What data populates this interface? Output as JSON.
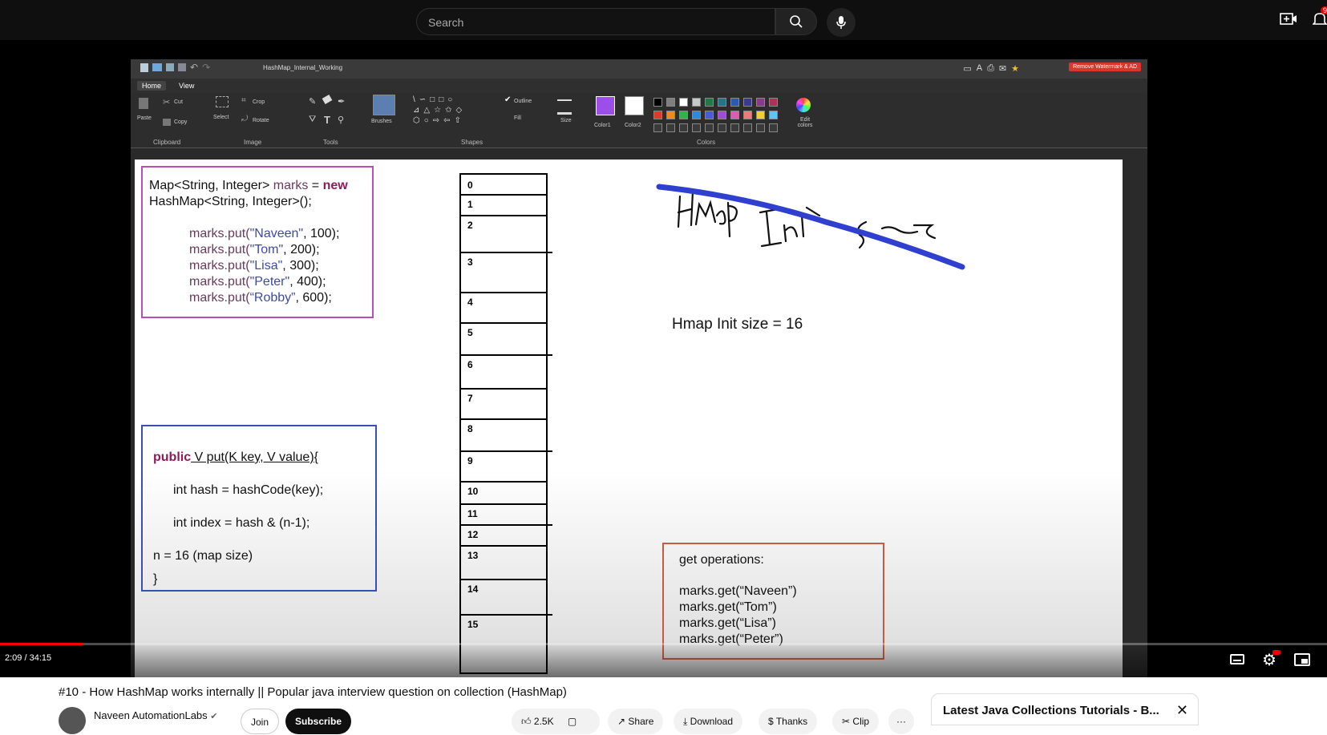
{
  "topbar": {
    "search_placeholder": "Search",
    "notification_count": "9"
  },
  "paint": {
    "file_title": "HashMap_Internal_Working",
    "watermark_button": "Remove Watermark & AD",
    "tabs": [
      "Home",
      "View"
    ],
    "ribbon": {
      "paste": "Paste",
      "cut": "Cut",
      "copy": "Copy",
      "select": "Select",
      "crop": "Crop",
      "rotate": "Rotate",
      "brushes": "Brushes",
      "outline": "Outline",
      "fill": "Fill",
      "size": "Size",
      "color1": "Color1",
      "color2": "Color2",
      "edit_colors": "Edit colors",
      "sections": [
        "Clipboard",
        "Image",
        "Tools",
        "Shapes",
        "Colors"
      ]
    },
    "palette_top": [
      "#000000",
      "#7f7f7f",
      "#ffffff",
      "#c8c8c8",
      "#1f7a4a",
      "#1a7a8a",
      "#2a5ab8",
      "#3a3a9a",
      "#8a3a8a",
      "#b0305a"
    ],
    "palette_bottom": [
      "#e03a2a",
      "#f08a1a",
      "#2ab84a",
      "#2a8ae0",
      "#4a5ae0",
      "#a04ae0",
      "#e05ab0",
      "#f07a7a",
      "#f0d030",
      "#5ac8f0"
    ],
    "color1": "#9b4ee8",
    "color2": "#ffffff"
  },
  "canvas": {
    "code_block_1": {
      "line1_a": "Map<String, Integer> ",
      "line1_var": "marks",
      "line1_eq": " = ",
      "line1_kw": "new",
      "line2": "HashMap<String, Integer>();",
      "puts": [
        {
          "prefix": "marks.put(",
          "key": "\"Naveen\"",
          "rest": ", 100);"
        },
        {
          "prefix": "marks.put(",
          "key": "\"Tom\"",
          "rest": ", 200);"
        },
        {
          "prefix": "marks.put(",
          "key": "\"Lisa\"",
          "rest": ", 300);"
        },
        {
          "prefix": "marks.put(",
          "key": "\"Peter\"",
          "rest": ", 400);"
        },
        {
          "prefix": "marks.put(",
          "key": "“Robby”",
          "rest": ", 600);"
        }
      ]
    },
    "code_block_2": {
      "kw": "public",
      "sig": " V put(K key, V value){",
      "line2": "int hash = hashCode(key);",
      "line3": "int index = hash & (n-1);",
      "line4": "n = 16 (map size)",
      "line5": "}"
    },
    "buckets": [
      "0",
      "1",
      "2",
      "3",
      "4",
      "5",
      "6",
      "7",
      "8",
      "9",
      "10",
      "11",
      "12",
      "13",
      "14",
      "15"
    ],
    "hmap_init": "Hmap Init size = 16",
    "get_block": {
      "title": "get operations:",
      "lines": [
        "marks.get(“Naveen”)",
        "marks.get(“Tom”)",
        "marks.get(“Lisa”)",
        "marks.get(“Peter”)"
      ]
    }
  },
  "player": {
    "time": "2:09 / 34:15",
    "progress": 0.0627
  },
  "info": {
    "title": "#10 - How HashMap works internally || Popular java interview question on collection (HashMap)",
    "channel": "Naveen AutomationLabs",
    "join": "Join",
    "subscribe": "Subscribe",
    "likes": "2.5K",
    "share": "Share",
    "download": "Download",
    "thanks": "Thanks",
    "clip": "Clip",
    "playlist_title": "Latest Java Collections Tutorials - B..."
  }
}
